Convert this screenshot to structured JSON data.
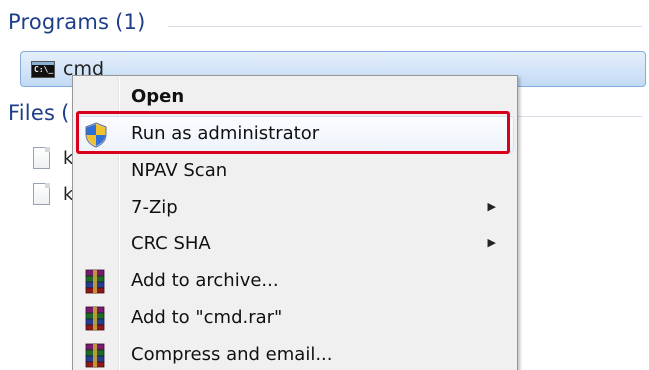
{
  "groups": {
    "programs": {
      "title": "Programs",
      "count": "(1)"
    },
    "files": {
      "title": "Files",
      "count": "("
    }
  },
  "program_row": {
    "label": "cmd",
    "icon": "command-prompt-icon",
    "icon_text": "C:\\_"
  },
  "file_rows": [
    {
      "label": "k",
      "icon": "document-icon"
    },
    {
      "label": "k",
      "icon": "document-icon"
    }
  ],
  "context_menu": {
    "items": [
      {
        "label": "Open",
        "bold": true,
        "icon": ""
      },
      {
        "label": "Run as administrator",
        "icon": "uac-shield-icon",
        "highlighted": true
      },
      {
        "label": "NPAV Scan",
        "icon": ""
      },
      {
        "label": "7-Zip",
        "icon": "",
        "submenu": true
      },
      {
        "label": "CRC SHA",
        "icon": "",
        "submenu": true
      },
      {
        "label": "Add to archive...",
        "icon": "winrar-books-icon"
      },
      {
        "label": "Add to \"cmd.rar\"",
        "icon": "winrar-books-icon"
      },
      {
        "label": "Compress and email...",
        "icon": "winrar-books-icon"
      }
    ],
    "submenu_arrow": "▶"
  },
  "colors": {
    "header_text": "#1e3e8a",
    "selection_border": "#84acdd",
    "menu_background": "#f0f0f0",
    "callout_red": "#d9001b"
  }
}
